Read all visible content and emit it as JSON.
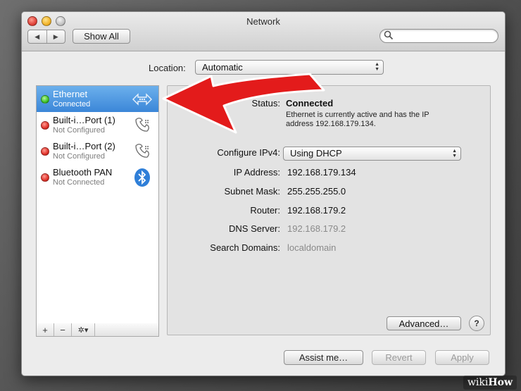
{
  "window": {
    "title": "Network"
  },
  "toolbar": {
    "back_icon": "◀",
    "forward_icon": "▶",
    "show_all_label": "Show All",
    "search_placeholder": ""
  },
  "location": {
    "label": "Location:",
    "value": "Automatic"
  },
  "sidebar": {
    "items": [
      {
        "name": "Ethernet",
        "status": "Connected",
        "status_color": "green",
        "icon": "ethernet-icon",
        "selected": true
      },
      {
        "name": "Built-i…Port (1)",
        "status": "Not Configured",
        "status_color": "red",
        "icon": "phone-modem-icon",
        "selected": false
      },
      {
        "name": "Built-i…Port (2)",
        "status": "Not Configured",
        "status_color": "red",
        "icon": "phone-modem-icon",
        "selected": false
      },
      {
        "name": "Bluetooth PAN",
        "status": "Not Connected",
        "status_color": "red",
        "icon": "bluetooth-icon",
        "selected": false
      }
    ],
    "footer": {
      "add": "+",
      "remove": "−",
      "gear": "✲▾"
    }
  },
  "detail": {
    "status_label": "Status:",
    "status_value": "Connected",
    "status_desc": "Ethernet is currently active and has the IP address 192.168.179.134.",
    "configure_label": "Configure IPv4:",
    "configure_value": "Using DHCP",
    "ip_label": "IP Address:",
    "ip_value": "192.168.179.134",
    "subnet_label": "Subnet Mask:",
    "subnet_value": "255.255.255.0",
    "router_label": "Router:",
    "router_value": "192.168.179.2",
    "dns_label": "DNS Server:",
    "dns_value": "192.168.179.2",
    "search_domains_label": "Search Domains:",
    "search_domains_value": "localdomain",
    "advanced_label": "Advanced…",
    "help_label": "?"
  },
  "buttons": {
    "assist": "Assist me…",
    "revert": "Revert",
    "apply": "Apply"
  },
  "watermark": {
    "wiki": "wiki",
    "how": "How"
  },
  "colors": {
    "selection": "#3b86d8",
    "annotation_arrow": "#e31b1b"
  }
}
